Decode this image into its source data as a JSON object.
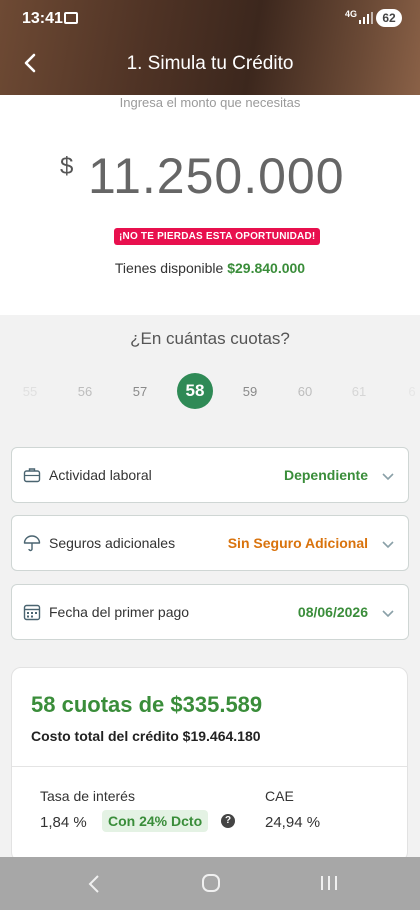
{
  "status_bar": {
    "time": "13:41",
    "network": "4G",
    "battery": "62"
  },
  "nav": {
    "title": "1. Simula tu Crédito"
  },
  "amount": {
    "hint": "Ingresa el monto que necesitas",
    "currency": "$",
    "value": "11.250.000",
    "promo": "¡NO TE PIERDAS ESTA OPORTUNIDAD!",
    "available_label": "Tienes disponible",
    "available_value": "$29.840.000"
  },
  "cuotas": {
    "question": "¿En cuántas cuotas?",
    "options": [
      "55",
      "56",
      "57",
      "58",
      "59",
      "60",
      "61",
      "6"
    ],
    "selected": "58"
  },
  "options": {
    "actividad": {
      "label": "Actividad laboral",
      "value": "Dependiente",
      "value_color": "#3a8d3a",
      "icon": "briefcase-icon"
    },
    "seguros": {
      "label": "Seguros adicionales",
      "value": "Sin Seguro Adicional",
      "value_color": "#d9730d",
      "icon": "umbrella-icon"
    },
    "fecha": {
      "label": "Fecha del primer pago",
      "value": "08/06/2026",
      "value_color": "#3a8d3a",
      "icon": "calendar-icon"
    }
  },
  "result": {
    "cuotas_total": "58 cuotas de $335.589",
    "costo_total": "Costo total del crédito $19.464.180",
    "tasa_label": "Tasa de interés",
    "tasa_value": "1,84 %",
    "descuento": "Con 24% Dcto",
    "help": "?",
    "cae_label": "CAE",
    "cae_value": "24,94 %"
  },
  "colors": {
    "accent_green": "#2f8a56",
    "promo_red": "#e8104e",
    "orange": "#d9730d"
  }
}
